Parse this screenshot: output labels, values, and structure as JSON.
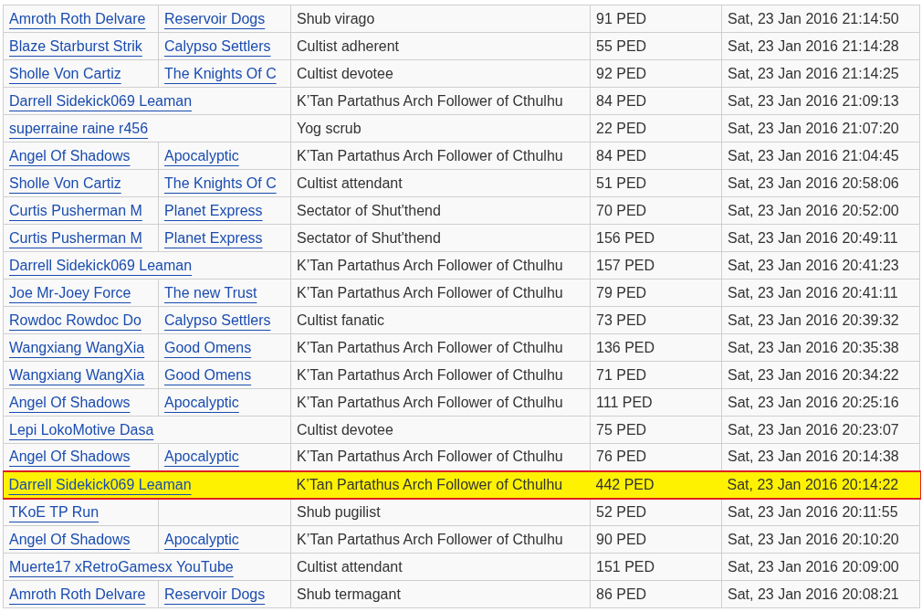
{
  "rows": [
    {
      "player": "Amroth Roth Delvare",
      "span": false,
      "society": "Reservoir Dogs",
      "creature": "Shub virago",
      "value": "91 PED",
      "time": "Sat, 23 Jan 2016 21:14:50",
      "selected": false
    },
    {
      "player": "Blaze Starburst Strik",
      "span": false,
      "society": "Calypso Settlers",
      "creature": "Cultist adherent",
      "value": "55 PED",
      "time": "Sat, 23 Jan 2016 21:14:28",
      "selected": false
    },
    {
      "player": "Sholle Von Cartiz",
      "span": false,
      "society": "The Knights Of C",
      "creature": "Cultist devotee",
      "value": "92 PED",
      "time": "Sat, 23 Jan 2016 21:14:25",
      "selected": false
    },
    {
      "player": "Darrell Sidekick069 Leaman",
      "span": true,
      "creature": "K’Tan Partathus Arch Follower of Cthulhu",
      "value": "84 PED",
      "time": "Sat, 23 Jan 2016 21:09:13",
      "selected": false
    },
    {
      "player": "superraine raine r456",
      "span": true,
      "creature": "Yog scrub",
      "value": "22 PED",
      "time": "Sat, 23 Jan 2016 21:07:20",
      "selected": false
    },
    {
      "player": "Angel Of Shadows",
      "span": false,
      "society": "Apocalyptic",
      "creature": "K’Tan Partathus Arch Follower of Cthulhu",
      "value": "84 PED",
      "time": "Sat, 23 Jan 2016 21:04:45",
      "selected": false
    },
    {
      "player": "Sholle Von Cartiz",
      "span": false,
      "society": "The Knights Of C",
      "creature": "Cultist attendant",
      "value": "51 PED",
      "time": "Sat, 23 Jan 2016 20:58:06",
      "selected": false
    },
    {
      "player": "Curtis Pusherman M",
      "span": false,
      "society": "Planet Express",
      "creature": "Sectator of Shut'thend",
      "value": "70 PED",
      "time": "Sat, 23 Jan 2016 20:52:00",
      "selected": false
    },
    {
      "player": "Curtis Pusherman M",
      "span": false,
      "society": "Planet Express",
      "creature": "Sectator of Shut'thend",
      "value": "156 PED",
      "time": "Sat, 23 Jan 2016 20:49:11",
      "selected": false
    },
    {
      "player": "Darrell Sidekick069 Leaman",
      "span": true,
      "creature": "K’Tan Partathus Arch Follower of Cthulhu",
      "value": "157 PED",
      "time": "Sat, 23 Jan 2016 20:41:23",
      "selected": false
    },
    {
      "player": "Joe Mr-Joey Force",
      "span": false,
      "society": "The new Trust",
      "creature": "K’Tan Partathus Arch Follower of Cthulhu",
      "value": "79 PED",
      "time": "Sat, 23 Jan 2016 20:41:11",
      "selected": false
    },
    {
      "player": "Rowdoc Rowdoc Do",
      "span": false,
      "society": "Calypso Settlers",
      "creature": "Cultist fanatic",
      "value": "73 PED",
      "time": "Sat, 23 Jan 2016 20:39:32",
      "selected": false
    },
    {
      "player": "Wangxiang WangXia",
      "span": false,
      "society": "Good Omens",
      "creature": "K’Tan Partathus Arch Follower of Cthulhu",
      "value": "136 PED",
      "time": "Sat, 23 Jan 2016 20:35:38",
      "selected": false
    },
    {
      "player": "Wangxiang WangXia",
      "span": false,
      "society": "Good Omens",
      "creature": "K’Tan Partathus Arch Follower of Cthulhu",
      "value": "71 PED",
      "time": "Sat, 23 Jan 2016 20:34:22",
      "selected": false
    },
    {
      "player": "Angel Of Shadows",
      "span": false,
      "society": "Apocalyptic",
      "creature": "K’Tan Partathus Arch Follower of Cthulhu",
      "value": "111 PED",
      "time": "Sat, 23 Jan 2016 20:25:16",
      "selected": false
    },
    {
      "player": "Lepi LokoMotive Dasa",
      "span": true,
      "creature": "Cultist devotee",
      "value": "75 PED",
      "time": "Sat, 23 Jan 2016 20:23:07",
      "selected": false
    },
    {
      "player": "Angel Of Shadows",
      "span": false,
      "society": "Apocalyptic",
      "creature": "K’Tan Partathus Arch Follower of Cthulhu",
      "value": "76 PED",
      "time": "Sat, 23 Jan 2016 20:14:38",
      "selected": false
    },
    {
      "player": "Darrell Sidekick069 Leaman",
      "span": true,
      "creature": "K’Tan Partathus Arch Follower of Cthulhu",
      "value": "442 PED",
      "time": "Sat, 23 Jan 2016 20:14:22",
      "selected": true
    },
    {
      "player": "TKoE TP Run",
      "span": false,
      "creature": "Shub pugilist",
      "value": "52 PED",
      "time": "Sat, 23 Jan 2016 20:11:55",
      "selected": false
    },
    {
      "player": "Angel Of Shadows",
      "span": false,
      "society": "Apocalyptic",
      "creature": "K’Tan Partathus Arch Follower of Cthulhu",
      "value": "90 PED",
      "time": "Sat, 23 Jan 2016 20:10:20",
      "selected": false
    },
    {
      "player": "Muerte17 xRetroGamesx YouTube",
      "span": true,
      "creature": "Cultist attendant",
      "value": "151 PED",
      "time": "Sat, 23 Jan 2016 20:09:00",
      "selected": false
    },
    {
      "player": "Amroth Roth Delvare",
      "span": false,
      "society": "Reservoir Dogs",
      "creature": "Shub termagant",
      "value": "86 PED",
      "time": "Sat, 23 Jan 2016 20:08:21",
      "selected": false
    }
  ]
}
